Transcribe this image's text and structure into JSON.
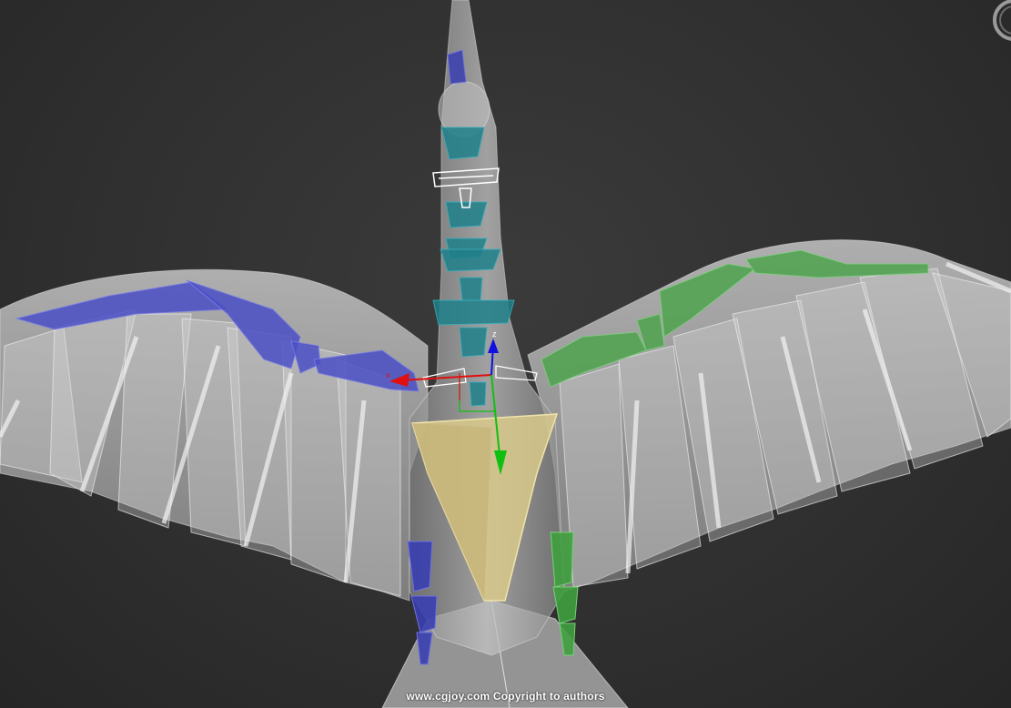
{
  "viewport": {
    "background_color": "#333333",
    "subject": "bird rig with biped skeleton, wings spread"
  },
  "colors": {
    "left_bones": "#4a4fc4",
    "right_bones": "#4fa34f",
    "spine_bones": "#1f7f8a",
    "pelvis": "#d9c98a",
    "mesh": "#c8c8c8",
    "gizmo_x": "#e01010",
    "gizmo_y": "#10c010",
    "gizmo_z": "#1010e0"
  },
  "gizmo": {
    "x_label": "x",
    "z_label": "z"
  },
  "watermark": {
    "text": "www.cgjoy.com Copyright to authors"
  },
  "icons": {
    "viewcube": "viewcube-ring-icon"
  }
}
